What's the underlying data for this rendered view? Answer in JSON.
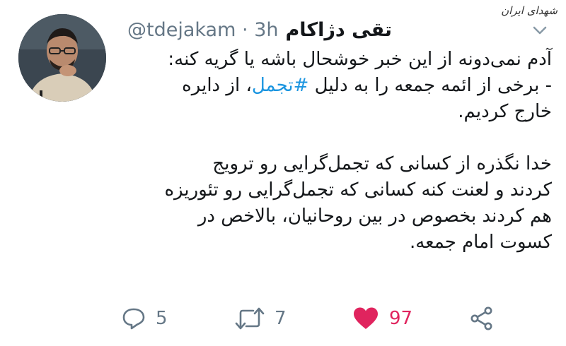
{
  "watermark": "شهدای ایران",
  "author": {
    "name": "تقی دژاکام",
    "handle": "@tdejakam",
    "separator": "·",
    "time": "3h"
  },
  "tweet": {
    "line1": "آدم نمی‌دونه از این خبر خوشحال باشه یا گریه کنه:",
    "line2_before": "- برخی از ائمه جمعه را به دلیل ",
    "hashtag": "#تجمل",
    "line2_after": "، از دایره",
    "line3": "خارج کردیم.",
    "para2": [
      "خدا نگذره از کسانی که تجمل‌گرایی رو ترویج",
      "کردند و لعنت کنه کسانی که تجمل‌گرایی رو تئوریزه",
      "هم کردند بخصوص در بین روحانیان، بالاخص در",
      "کسوت امام جمعه."
    ]
  },
  "actions": {
    "reply_count": "5",
    "retweet_count": "7",
    "like_count": "97"
  },
  "colors": {
    "accent": "#1b95e0",
    "like": "#e0245e",
    "muted": "#657786"
  }
}
